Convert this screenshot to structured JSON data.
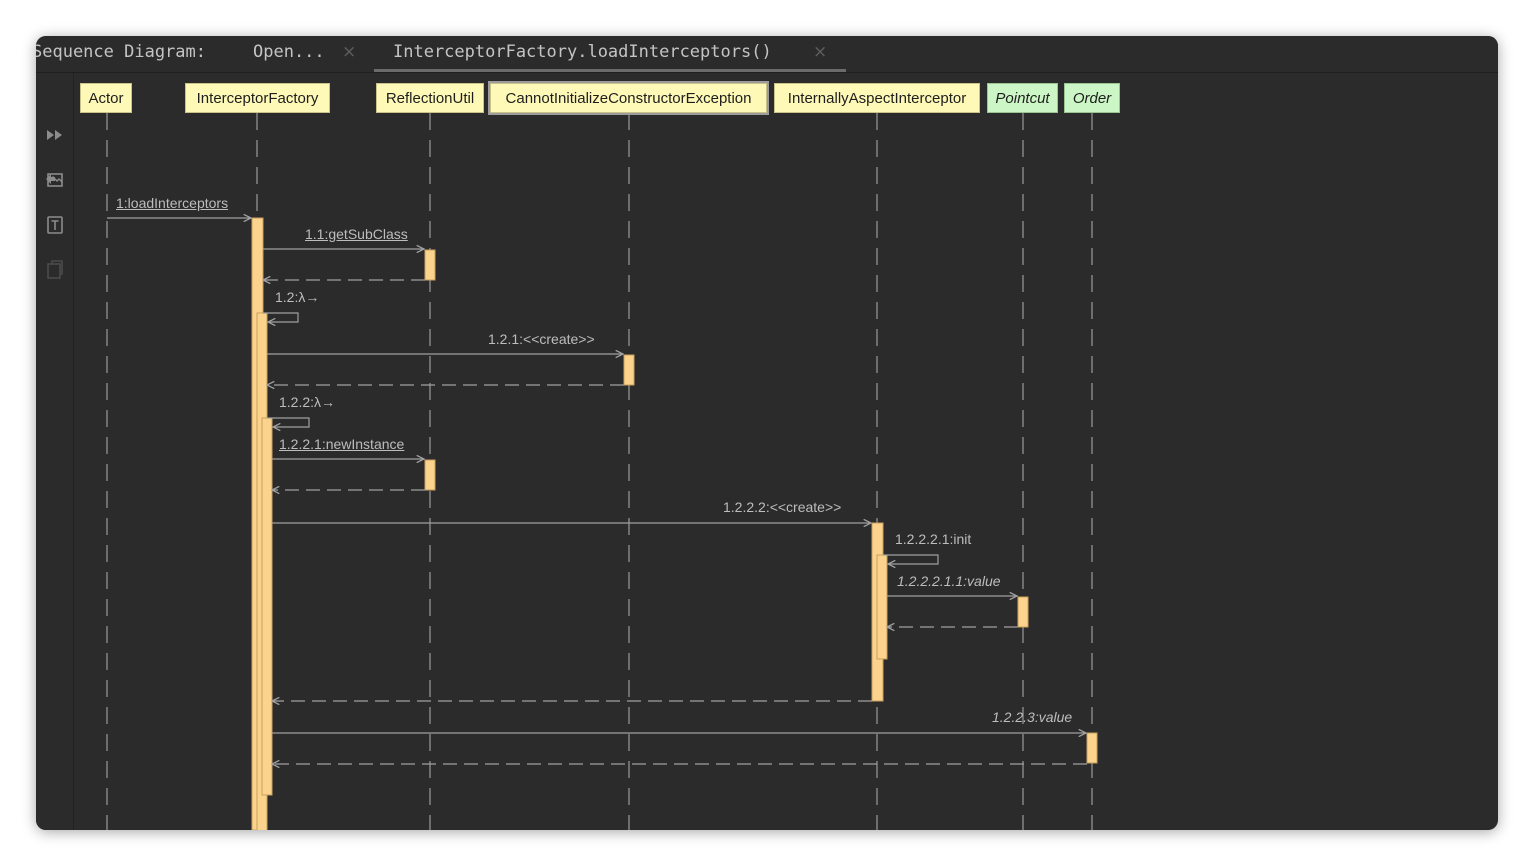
{
  "tabs": {
    "title_label": "Sequence Diagram:",
    "items": [
      {
        "label": "Open...",
        "active": false
      },
      {
        "label": "InterceptorFactory.loadInterceptors()",
        "active": true
      }
    ],
    "close_glyph": "×"
  },
  "toolbar": {
    "icons": [
      "fast-forward-icon",
      "export-image-icon",
      "text-export-icon",
      "copy-icon"
    ]
  },
  "participants": [
    {
      "id": "actor",
      "label": "Actor",
      "kind": "yellow"
    },
    {
      "id": "factory",
      "label": "InterceptorFactory",
      "kind": "yellow"
    },
    {
      "id": "reflection",
      "label": "ReflectionUtil",
      "kind": "yellow"
    },
    {
      "id": "exception",
      "label": "CannotInitializeConstructorException",
      "kind": "yellow",
      "selected": true
    },
    {
      "id": "aspect",
      "label": "InternallyAspectInterceptor",
      "kind": "yellow"
    },
    {
      "id": "pointcut",
      "label": "Pointcut",
      "kind": "green"
    },
    {
      "id": "order",
      "label": "Order",
      "kind": "green"
    }
  ],
  "messages": [
    {
      "label": "1:loadInterceptors",
      "style": "underline"
    },
    {
      "label": "1.1:getSubClass",
      "style": "underline"
    },
    {
      "label": "1.2:λ→",
      "style": "plain"
    },
    {
      "label": "1.2.1:<<create>>",
      "style": "plain"
    },
    {
      "label": "1.2.2:λ→",
      "style": "plain"
    },
    {
      "label": "1.2.2.1:newInstance",
      "style": "underline"
    },
    {
      "label": "1.2.2.2:<<create>>",
      "style": "plain"
    },
    {
      "label": "1.2.2.2.1:init",
      "style": "plain"
    },
    {
      "label": "1.2.2.2.1.1:value",
      "style": "italic"
    },
    {
      "label": "1.2.2.3:value",
      "style": "italic"
    }
  ],
  "colors": {
    "background": "#2b2b2b",
    "lifeline": "#8a8a8a",
    "activation_fill": "#fbd38d",
    "activation_stroke": "#c8a060",
    "message_line": "#a0a0a0",
    "participant_yellow": "#fff9b7",
    "participant_green": "#cdf6c6"
  }
}
